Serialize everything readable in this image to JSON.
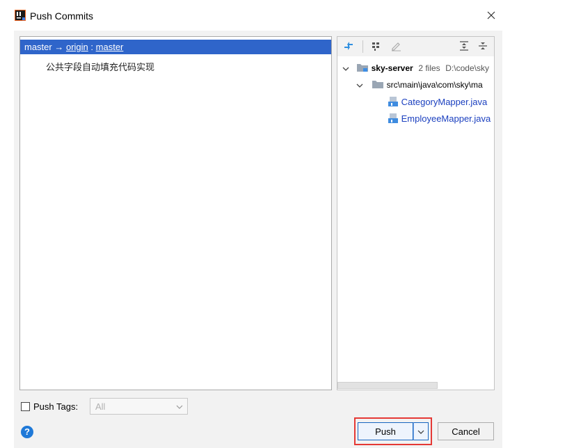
{
  "window": {
    "title": "Push Commits"
  },
  "commits": {
    "branch": {
      "local": "master",
      "arrow": "→",
      "remote": "origin",
      "separator": ":",
      "remote_branch": "master"
    },
    "messages": [
      "公共字段自动填充代码实现"
    ]
  },
  "files": {
    "root": {
      "name": "sky-server",
      "count": "2 files",
      "path": "D:\\code\\sky"
    },
    "folder": {
      "name": "src\\main\\java\\com\\sky\\ma"
    },
    "items": [
      "CategoryMapper.java",
      "EmployeeMapper.java"
    ]
  },
  "footer": {
    "push_tags_label": "Push Tags:",
    "push_tags_value": "All",
    "push_label": "Push",
    "cancel_label": "Cancel",
    "help_glyph": "?"
  },
  "colors": {
    "selection": "#2f65ca",
    "highlight": "#e53935",
    "file_link": "#1a3fbf"
  }
}
